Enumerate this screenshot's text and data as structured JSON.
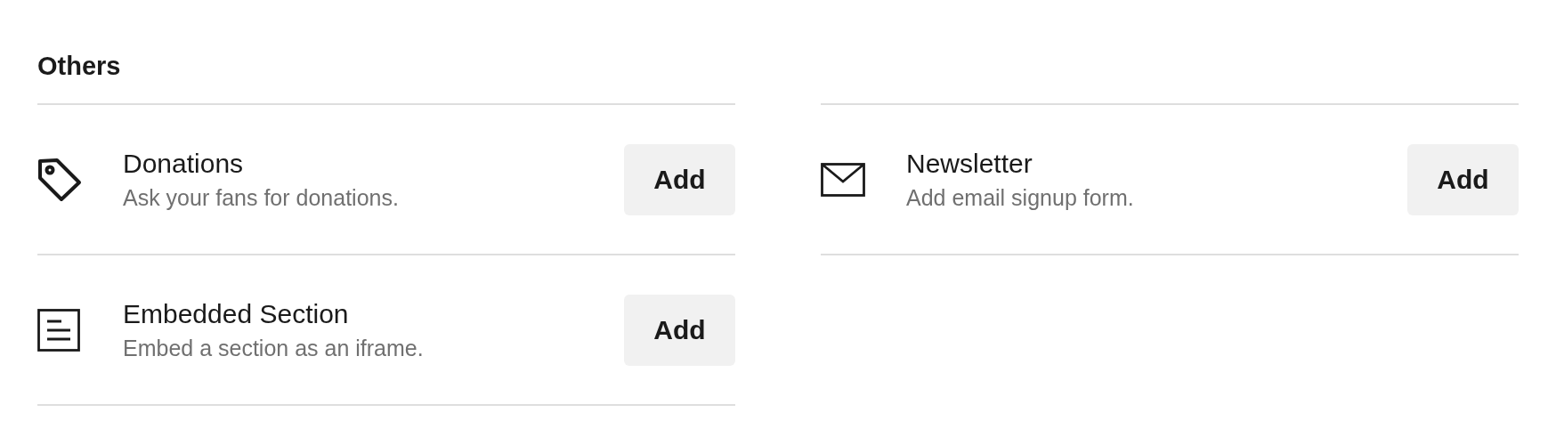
{
  "section": {
    "title": "Others"
  },
  "items": [
    {
      "kind": "tag",
      "title": "Donations",
      "description": "Ask your fans for donations.",
      "button": "Add"
    },
    {
      "kind": "envelope",
      "title": "Newsletter",
      "description": "Add email signup form.",
      "button": "Add"
    },
    {
      "kind": "document",
      "title": "Embedded Section",
      "description": "Embed a section as an iframe.",
      "button": "Add"
    }
  ]
}
